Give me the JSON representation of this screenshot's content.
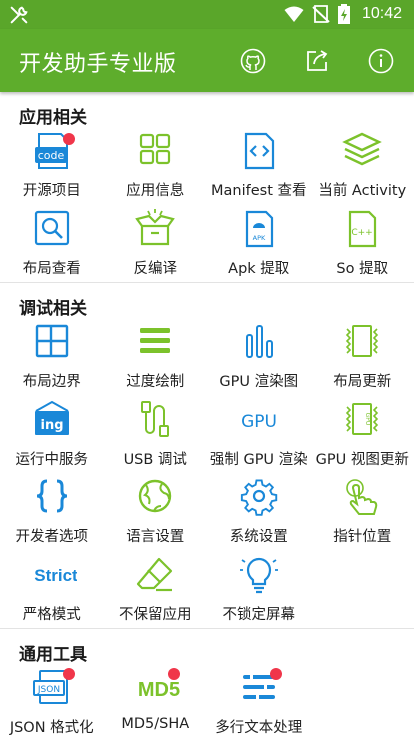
{
  "status_bar": {
    "time": "10:42"
  },
  "app_bar": {
    "title": "开发助手专业版"
  },
  "sections": [
    {
      "title": "应用相关",
      "items": [
        {
          "label": "开源项目",
          "icon": "code-icon",
          "badge": true
        },
        {
          "label": "应用信息",
          "icon": "grid-icon"
        },
        {
          "label": "Manifest 查看",
          "icon": "manifest-file-icon"
        },
        {
          "label": "当前 Activity",
          "icon": "layers-icon"
        },
        {
          "label": "布局查看",
          "icon": "layout-search-icon"
        },
        {
          "label": "反编译",
          "icon": "box-decompile-icon"
        },
        {
          "label": "Apk 提取",
          "icon": "apk-file-icon"
        },
        {
          "label": "So 提取",
          "icon": "so-file-icon"
        }
      ]
    },
    {
      "title": "调试相关",
      "items": [
        {
          "label": "布局边界",
          "icon": "layout-bounds-icon"
        },
        {
          "label": "过度绘制",
          "icon": "overdraw-icon"
        },
        {
          "label": "GPU 渲染图",
          "icon": "bar-graph-icon"
        },
        {
          "label": "布局更新",
          "icon": "layout-update-icon"
        },
        {
          "label": "运行中服务",
          "icon": "running-services-icon"
        },
        {
          "label": "USB 调试",
          "icon": "usb-cable-icon"
        },
        {
          "label": "强制 GPU 渲染",
          "icon": "gpu-text-icon"
        },
        {
          "label": "GPU 视图更新",
          "icon": "gpu-chip-icon"
        },
        {
          "label": "开发者选项",
          "icon": "braces-icon"
        },
        {
          "label": "语言设置",
          "icon": "globe-icon"
        },
        {
          "label": "系统设置",
          "icon": "gear-icon"
        },
        {
          "label": "指针位置",
          "icon": "pointer-hand-icon"
        },
        {
          "label": "严格模式",
          "icon": "strict-icon",
          "text": "Strict"
        },
        {
          "label": "不保留应用",
          "icon": "eraser-icon"
        },
        {
          "label": "不锁定屏幕",
          "icon": "lightbulb-icon"
        }
      ]
    },
    {
      "title": "通用工具",
      "items": [
        {
          "label": "JSON 格式化",
          "icon": "json-icon",
          "badge": true,
          "text": "JSON"
        },
        {
          "label": "MD5/SHA",
          "icon": "md5-icon",
          "badge": true,
          "text": "MD5"
        },
        {
          "label": "多行文本处理",
          "icon": "text-lines-icon",
          "badge": true
        }
      ]
    }
  ],
  "icon_texts": {
    "code": "code",
    "apk": "APK",
    "so": "C++",
    "gpu": "GPU",
    "gpu_chip": "GPU",
    "ing": "ing"
  },
  "colors": {
    "accent_green": "#5ead2c",
    "blue": "#1a88d8",
    "green_icon": "#7cc22b",
    "badge_red": "#f0364a"
  }
}
